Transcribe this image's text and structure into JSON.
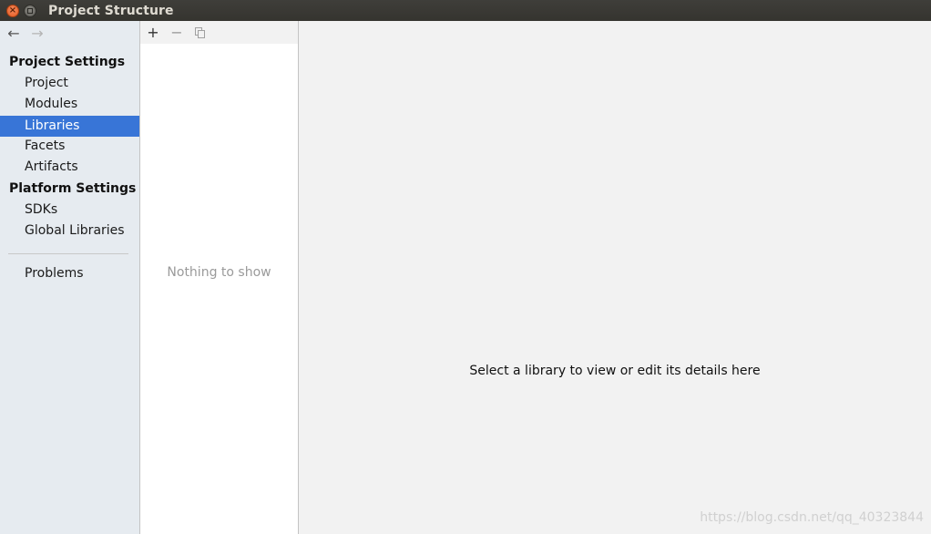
{
  "window": {
    "title": "Project Structure"
  },
  "nav": {
    "back_icon": "←",
    "forward_icon": "→"
  },
  "sidebar": {
    "project_settings_header": "Project Settings",
    "project_items": [
      {
        "label": "Project"
      },
      {
        "label": "Modules"
      },
      {
        "label": "Libraries",
        "selected": true
      },
      {
        "label": "Facets"
      },
      {
        "label": "Artifacts"
      }
    ],
    "platform_settings_header": "Platform Settings",
    "platform_items": [
      {
        "label": "SDKs"
      },
      {
        "label": "Global Libraries"
      }
    ],
    "problems_label": "Problems"
  },
  "list_panel": {
    "add_icon": "+",
    "remove_icon": "−",
    "empty_text": "Nothing to show"
  },
  "detail_panel": {
    "message": "Select a library to view or edit its details here",
    "watermark": "https://blog.csdn.net/qq_40323844"
  },
  "colors": {
    "selection": "#3875d7",
    "sidebar_bg": "#e6ebf0",
    "titlebar_bg": "#3f3e3a",
    "close_button": "#e45a21"
  }
}
